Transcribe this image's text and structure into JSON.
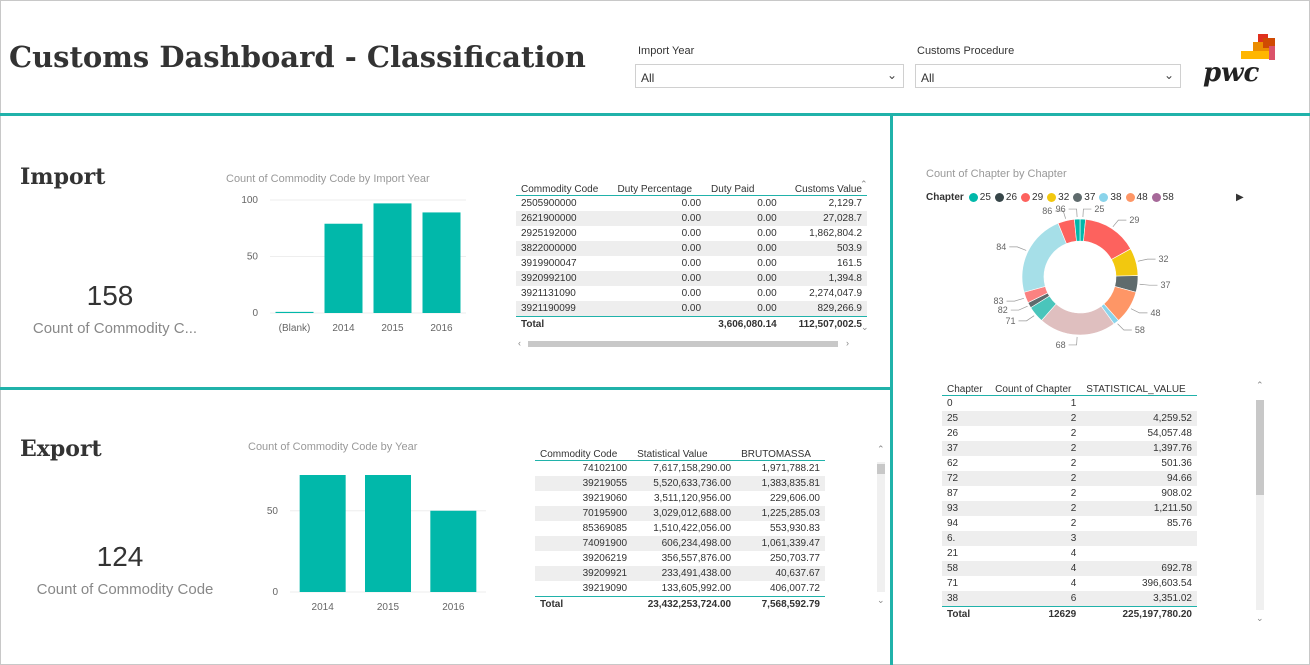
{
  "header": {
    "title": "Customs Dashboard - Classification",
    "slicers": [
      {
        "label": "Import Year",
        "value": "All"
      },
      {
        "label": "Customs Procedure",
        "value": "All"
      }
    ],
    "logo": "pwc"
  },
  "import": {
    "heading": "Import",
    "kpi_value": "158",
    "kpi_label": "Count of Commodity C...",
    "chart_title": "Count of Commodity Code by Import Year",
    "table": {
      "columns": [
        "Commodity Code",
        "Duty Percentage",
        "Duty Paid",
        "Customs Value"
      ],
      "rows": [
        [
          "2505900000",
          "0.00",
          "0.00",
          "2,129.7"
        ],
        [
          "2621900000",
          "0.00",
          "0.00",
          "27,028.7"
        ],
        [
          "2925192000",
          "0.00",
          "0.00",
          "1,862,804.2"
        ],
        [
          "3822000000",
          "0.00",
          "0.00",
          "503.9"
        ],
        [
          "3919900047",
          "0.00",
          "0.00",
          "161.5"
        ],
        [
          "3920992100",
          "0.00",
          "0.00",
          "1,394.8"
        ],
        [
          "3921131090",
          "0.00",
          "0.00",
          "2,274,047.9"
        ],
        [
          "3921190099",
          "0.00",
          "0.00",
          "829,266.9"
        ]
      ],
      "total": [
        "Total",
        "",
        "3,606,080.14",
        "112,507,002.5"
      ]
    }
  },
  "export": {
    "heading": "Export",
    "kpi_value": "124",
    "kpi_label": "Count of Commodity Code",
    "chart_title": "Count of Commodity Code by Year",
    "table": {
      "columns": [
        "Commodity Code",
        "Statistical Value",
        "BRUTOMASSA"
      ],
      "rows": [
        [
          "74102100",
          "7,617,158,290.00",
          "1,971,788.21"
        ],
        [
          "39219055",
          "5,520,633,736.00",
          "1,383,835.81"
        ],
        [
          "39219060",
          "3,511,120,956.00",
          "229,606.00"
        ],
        [
          "70195900",
          "3,029,012,688.00",
          "1,225,285.03"
        ],
        [
          "85369085",
          "1,510,422,056.00",
          "553,930.83"
        ],
        [
          "74091900",
          "606,234,498.00",
          "1,061,339.47"
        ],
        [
          "39206219",
          "356,557,876.00",
          "250,703.77"
        ],
        [
          "39209921",
          "233,491,438.00",
          "40,637.67"
        ],
        [
          "39219090",
          "133,605,992.00",
          "406,007.72"
        ]
      ],
      "total": [
        "Total",
        "23,432,253,724.00",
        "7,568,592.79"
      ]
    }
  },
  "chapter": {
    "chart_title": "Count of Chapter by Chapter",
    "legend_label": "Chapter",
    "legend": [
      {
        "name": "25",
        "color": "#01b8aa"
      },
      {
        "name": "26",
        "color": "#374649"
      },
      {
        "name": "29",
        "color": "#fd625e"
      },
      {
        "name": "32",
        "color": "#f2c80f"
      },
      {
        "name": "37",
        "color": "#5f6b6d"
      },
      {
        "name": "38",
        "color": "#8ad4eb"
      },
      {
        "name": "48",
        "color": "#fe9666"
      },
      {
        "name": "58",
        "color": "#a66999"
      }
    ],
    "table": {
      "columns": [
        "Chapter",
        "Count of Chapter",
        "STATISTICAL_VALUE"
      ],
      "rows": [
        [
          "0",
          "1",
          ""
        ],
        [
          "25",
          "2",
          "4,259.52"
        ],
        [
          "26",
          "2",
          "54,057.48"
        ],
        [
          "37",
          "2",
          "1,397.76"
        ],
        [
          "62",
          "2",
          "501.36"
        ],
        [
          "72",
          "2",
          "94.66"
        ],
        [
          "87",
          "2",
          "908.02"
        ],
        [
          "93",
          "2",
          "1,211.50"
        ],
        [
          "94",
          "2",
          "85.76"
        ],
        [
          "6.",
          "3",
          ""
        ],
        [
          "21",
          "4",
          ""
        ],
        [
          "58",
          "4",
          "692.78"
        ],
        [
          "71",
          "4",
          "396,603.54"
        ],
        [
          "38",
          "6",
          "3,351.02"
        ]
      ],
      "total": [
        "Total",
        "12629",
        "225,197,780.20"
      ]
    }
  },
  "chart_data": [
    {
      "type": "bar",
      "title": "Count of Commodity Code by Import Year",
      "categories": [
        "(Blank)",
        "2014",
        "2015",
        "2016"
      ],
      "values": [
        1,
        79,
        97,
        89
      ],
      "ylim": [
        0,
        100
      ],
      "yticks": [
        "0",
        "50",
        "100"
      ],
      "color": "#01b8aa"
    },
    {
      "type": "bar",
      "title": "Count of Commodity Code by Year",
      "categories": [
        "2014",
        "2015",
        "2016"
      ],
      "values": [
        72,
        72,
        50
      ],
      "ylim": [
        0,
        80
      ],
      "yticks": [
        "0",
        "50"
      ],
      "color": "#01b8aa"
    },
    {
      "type": "pie",
      "title": "Count of Chapter by Chapter",
      "labels": [
        "25",
        "29",
        "32",
        "37",
        "48",
        "58",
        "68",
        "71",
        "82",
        "83",
        "84",
        "86",
        "96"
      ],
      "values": [
        1,
        10,
        5,
        3,
        6,
        1,
        14,
        3,
        1,
        2,
        15,
        3,
        1
      ],
      "colors": [
        "#01b8aa",
        "#fd625e",
        "#f2c80f",
        "#5f6b6d",
        "#fe9666",
        "#8ad4eb",
        "#dfbfbf",
        "#4ac5bb",
        "#5f6b6d",
        "#fb8281",
        "#a6dfe8",
        "#fd625e",
        "#01b8aa"
      ]
    }
  ]
}
